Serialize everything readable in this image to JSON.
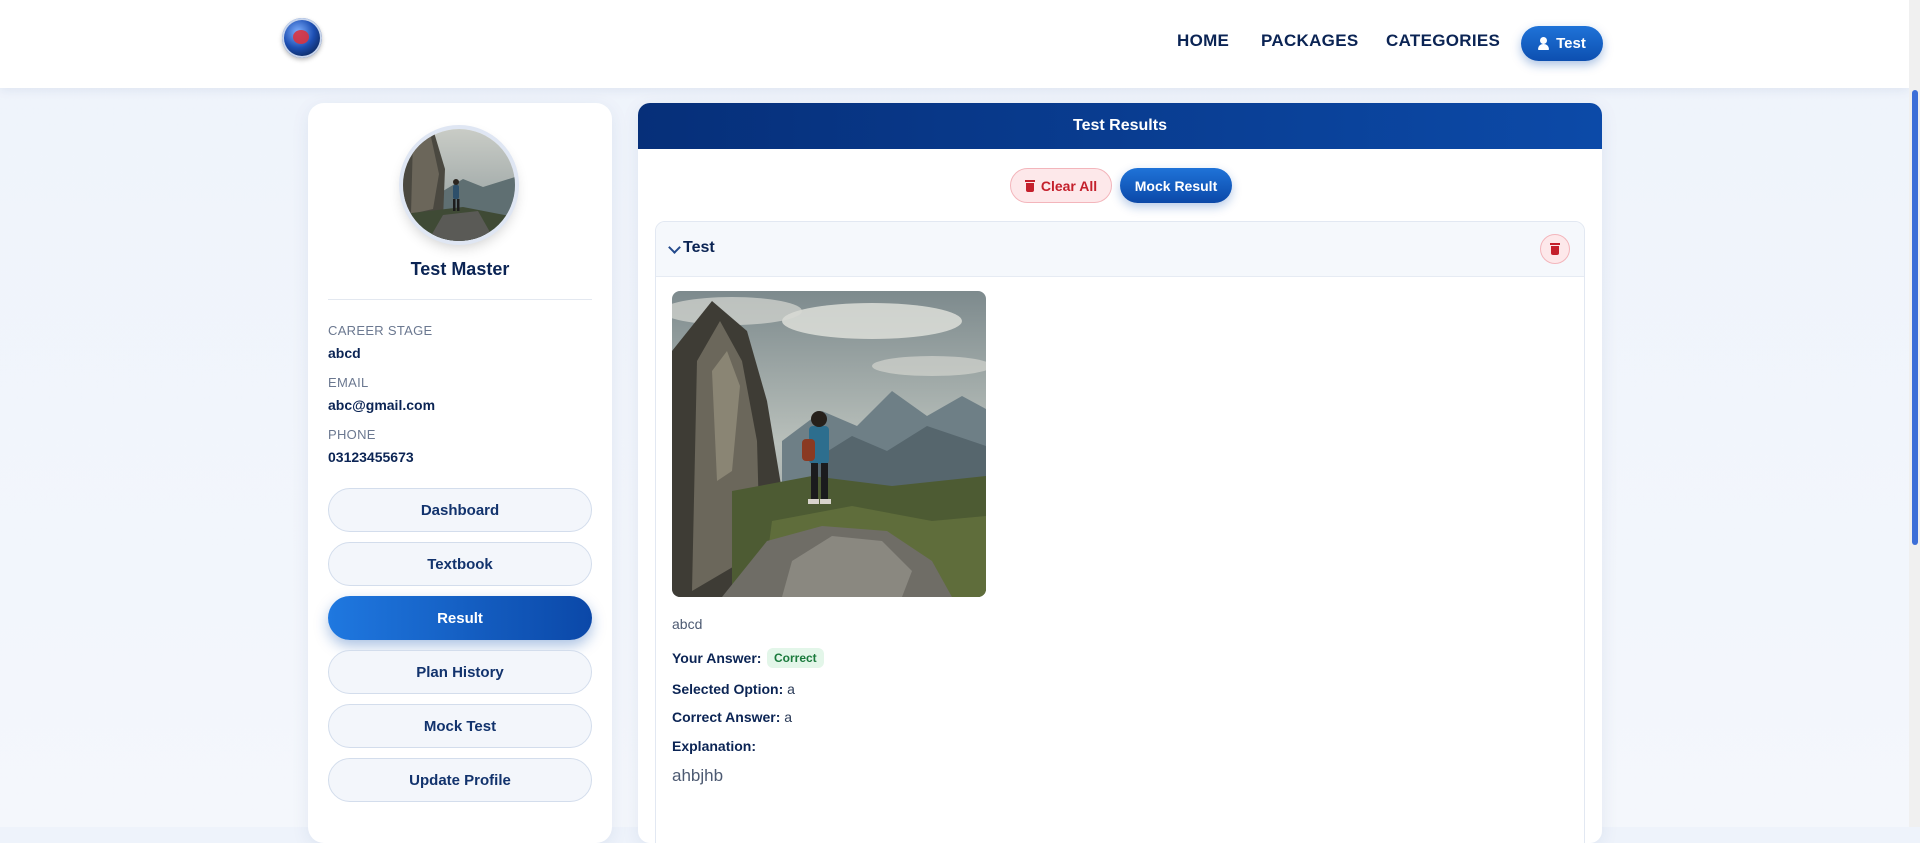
{
  "nav": {
    "links": [
      "HOME",
      "PACKAGES",
      "CATEGORIES"
    ],
    "user_label": "Test"
  },
  "profile": {
    "name": "Test Master",
    "career_stage_label": "CAREER STAGE",
    "career_stage": "abcd",
    "email_label": "EMAIL",
    "email": "abc@gmail.com",
    "phone_label": "PHONE",
    "phone": "03123455673"
  },
  "sidebar": {
    "items": [
      {
        "label": "Dashboard",
        "active": false
      },
      {
        "label": "Textbook",
        "active": false
      },
      {
        "label": "Result",
        "active": true
      },
      {
        "label": "Plan History",
        "active": false
      },
      {
        "label": "Mock Test",
        "active": false
      },
      {
        "label": "Update Profile",
        "active": false
      }
    ]
  },
  "main": {
    "header": "Test Results",
    "clear_all": "Clear All",
    "mock_result": "Mock Result",
    "test_title": "Test",
    "question": {
      "text": "abcd",
      "your_answer_label": "Your Answer:",
      "status": "Correct",
      "selected_label": "Selected Option:",
      "selected_value": "a",
      "correct_label": "Correct Answer:",
      "correct_value": "a",
      "explanation_label": "Explanation:",
      "explanation": "ahbjhb"
    }
  },
  "colors": {
    "brand": "#0b48a8",
    "accent": "#1f73d8",
    "danger": "#c4202c",
    "success": "#1a7a3c"
  }
}
